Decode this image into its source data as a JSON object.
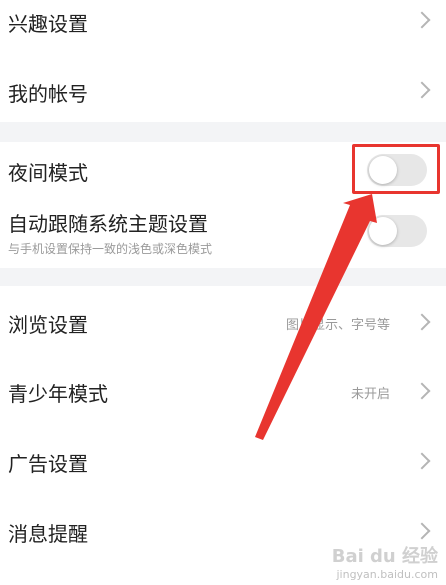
{
  "settings": {
    "interest": {
      "label": "兴趣设置"
    },
    "account": {
      "label": "我的帐号"
    },
    "night_mode": {
      "label": "夜间模式",
      "enabled": false
    },
    "follow_system": {
      "label": "自动跟随系统主题设置",
      "description": "与手机设置保持一致的浅色或深色模式",
      "enabled": false
    },
    "browse": {
      "label": "浏览设置",
      "value": "图片显示、字号等"
    },
    "teen_mode": {
      "label": "青少年模式",
      "value": "未开启"
    },
    "ads": {
      "label": "广告设置"
    },
    "notifications": {
      "label": "消息提醒"
    }
  },
  "watermark": {
    "brand": "Bai du 经验",
    "url": "jingyan.baidu.com"
  },
  "colors": {
    "highlight": "#e8352f",
    "toggle_off": "#e7e7e7",
    "section_gap": "#f3f4f6"
  }
}
